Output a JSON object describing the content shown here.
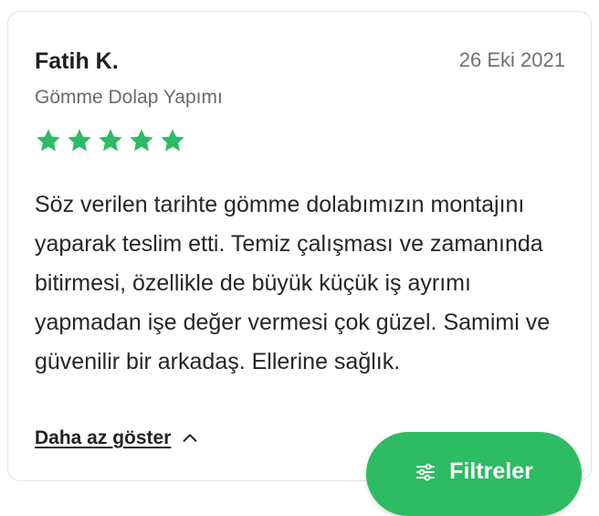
{
  "review": {
    "reviewer_name": "Fatih K.",
    "date": "26 Eki 2021",
    "service": "Gömme Dolap Yapımı",
    "rating": 5,
    "rating_max": 5,
    "text": "Söz verilen tarihte gömme dolabımızın montajını yaparak teslim etti. Temiz çalışması ve zamanında bitirmesi, özellikle de büyük küçük iş ayrımı yapmadan işe değer vermesi çok güzel. Samimi ve güvenilir bir arkadaş. Ellerine sağlık.",
    "toggle_label": "Daha az göster",
    "toggle_icon": "chevron-up-icon"
  },
  "filters_button": {
    "label": "Filtreler",
    "icon": "sliders-icon"
  },
  "colors": {
    "star": "#2dbb64",
    "button": "#2dbb64"
  }
}
